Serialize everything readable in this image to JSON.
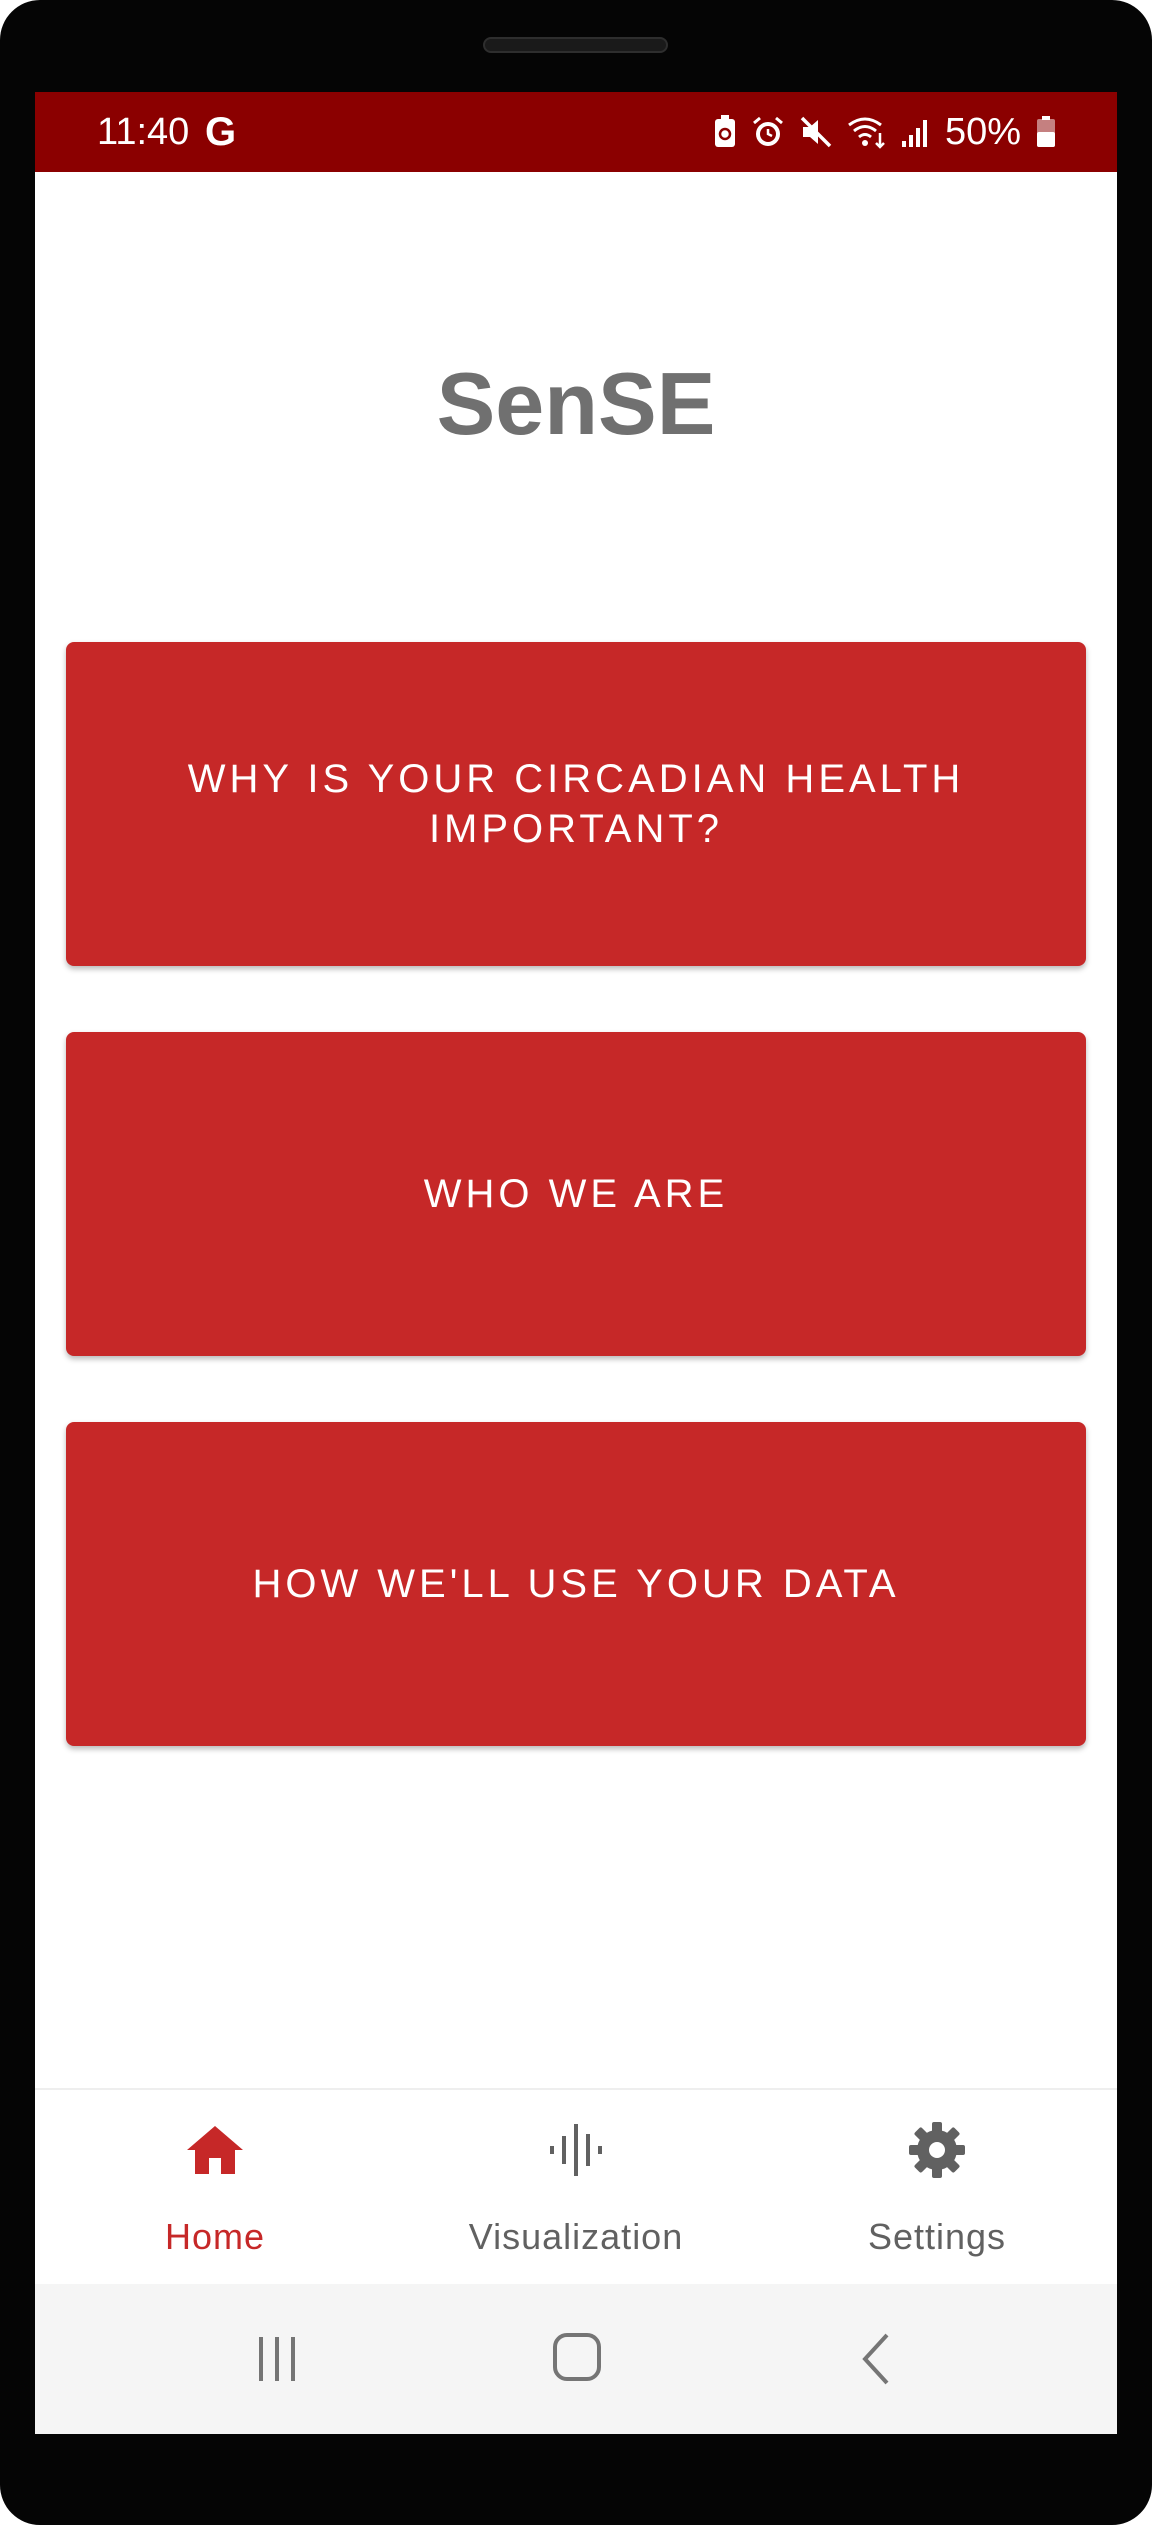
{
  "status_bar": {
    "time": "11:40",
    "g_label": "G",
    "battery_percent": "50%",
    "icons": [
      "battery-saver-icon",
      "alarm-icon",
      "mute-icon",
      "wifi-icon",
      "signal-icon",
      "battery-icon"
    ]
  },
  "app": {
    "title": "SenSE"
  },
  "buttons": [
    {
      "label": "WHY IS YOUR CIRCADIAN HEALTH IMPORTANT?"
    },
    {
      "label": "WHO WE ARE"
    },
    {
      "label": "HOW WE'LL USE YOUR DATA"
    }
  ],
  "bottom_nav": {
    "items": [
      {
        "label": "Home",
        "icon": "home-icon",
        "active": true
      },
      {
        "label": "Visualization",
        "icon": "waveform-icon",
        "active": false
      },
      {
        "label": "Settings",
        "icon": "gear-icon",
        "active": false
      }
    ]
  },
  "colors": {
    "status_bar": "#8b0000",
    "primary": "#c62828",
    "title_gray": "#707070",
    "nav_inactive": "#616161"
  }
}
